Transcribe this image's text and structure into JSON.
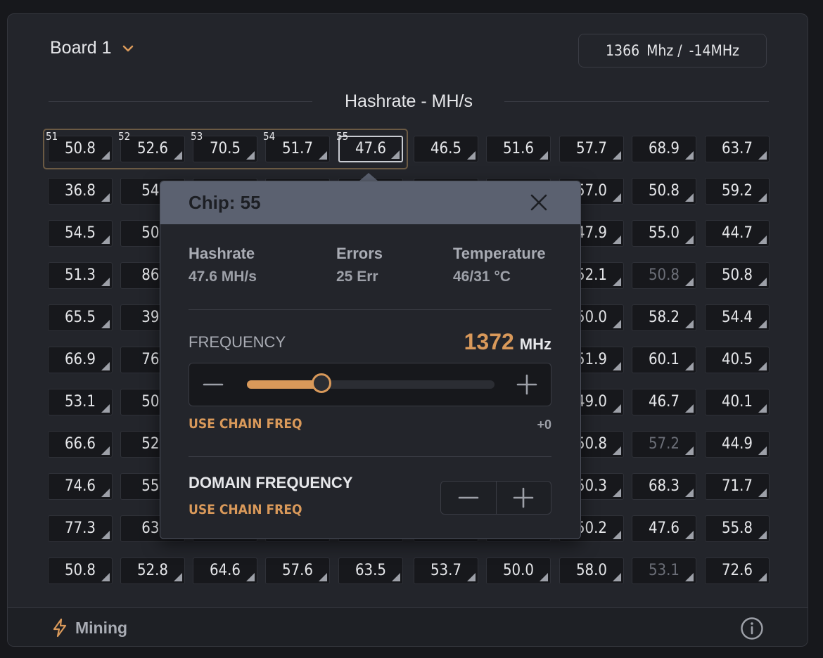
{
  "header": {
    "board_label": "Board 1",
    "freq_value": "1366",
    "freq_unit": "Mhz /",
    "freq_offset": "-14MHz"
  },
  "section": {
    "title": "Hashrate - MH/s"
  },
  "grid": {
    "rows": [
      [
        "50.8",
        "52.6",
        "70.5",
        "51.7",
        "47.6",
        "46.5",
        "51.6",
        "57.7",
        "68.9",
        "63.7"
      ],
      [
        "36.8",
        "54.",
        "",
        "",
        "",
        "",
        "",
        "57.0",
        "50.8",
        "59.2"
      ],
      [
        "54.5",
        "50.",
        "",
        "",
        "",
        "",
        "",
        "47.9",
        "55.0",
        "44.7"
      ],
      [
        "51.3",
        "86.",
        "",
        "",
        "",
        "",
        "",
        "52.1",
        "50.8",
        "50.8"
      ],
      [
        "65.5",
        "39.",
        "",
        "",
        "",
        "",
        "",
        "50.0",
        "58.2",
        "54.4"
      ],
      [
        "66.9",
        "76.",
        "",
        "",
        "",
        "",
        "",
        "51.9",
        "60.1",
        "40.5"
      ],
      [
        "53.1",
        "50.",
        "",
        "",
        "",
        "",
        "",
        "49.0",
        "46.7",
        "40.1"
      ],
      [
        "66.6",
        "52.",
        "",
        "",
        "",
        "",
        "",
        "50.8",
        "57.2",
        "44.9"
      ],
      [
        "74.6",
        "55.",
        "",
        "",
        "",
        "",
        "",
        "50.3",
        "68.3",
        "71.7"
      ],
      [
        "77.3",
        "63.",
        "",
        "",
        "",
        "",
        "",
        "50.2",
        "47.6",
        "55.8"
      ],
      [
        "50.8",
        "52.8",
        "64.6",
        "57.6",
        "63.5",
        "53.7",
        "50.0",
        "58.0",
        "53.1",
        "72.6"
      ]
    ],
    "dim_cells": [
      [
        3,
        8
      ],
      [
        7,
        8
      ],
      [
        10,
        8
      ]
    ],
    "selected_cell": [
      0,
      4
    ],
    "chip_numbers": [
      "51",
      "52",
      "53",
      "54",
      "55"
    ]
  },
  "popup": {
    "title": "Chip: 55",
    "hashrate_label": "Hashrate",
    "hashrate_value": "47.6 MH/s",
    "errors_label": "Errors",
    "errors_value": "25 Err",
    "temp_label": "Temperature",
    "temp_value": "46/31 °C",
    "frequency_label": "FREQUENCY",
    "frequency_value": "1372",
    "frequency_unit": "MHz",
    "slider_level": 0.3,
    "use_chain_freq": "USE CHAIN FREQ",
    "offset": "+0",
    "domain_label": "DOMAIN FREQUENCY",
    "domain_use_chain_freq": "USE CHAIN FREQ"
  },
  "footer": {
    "status": "Mining"
  },
  "colors": {
    "accent": "#d9995a",
    "panel": "#23252b",
    "cell": "#17181c"
  },
  "icons": [
    "chevron-down-icon",
    "close-icon",
    "minus-icon",
    "plus-icon",
    "bolt-icon",
    "info-icon"
  ]
}
